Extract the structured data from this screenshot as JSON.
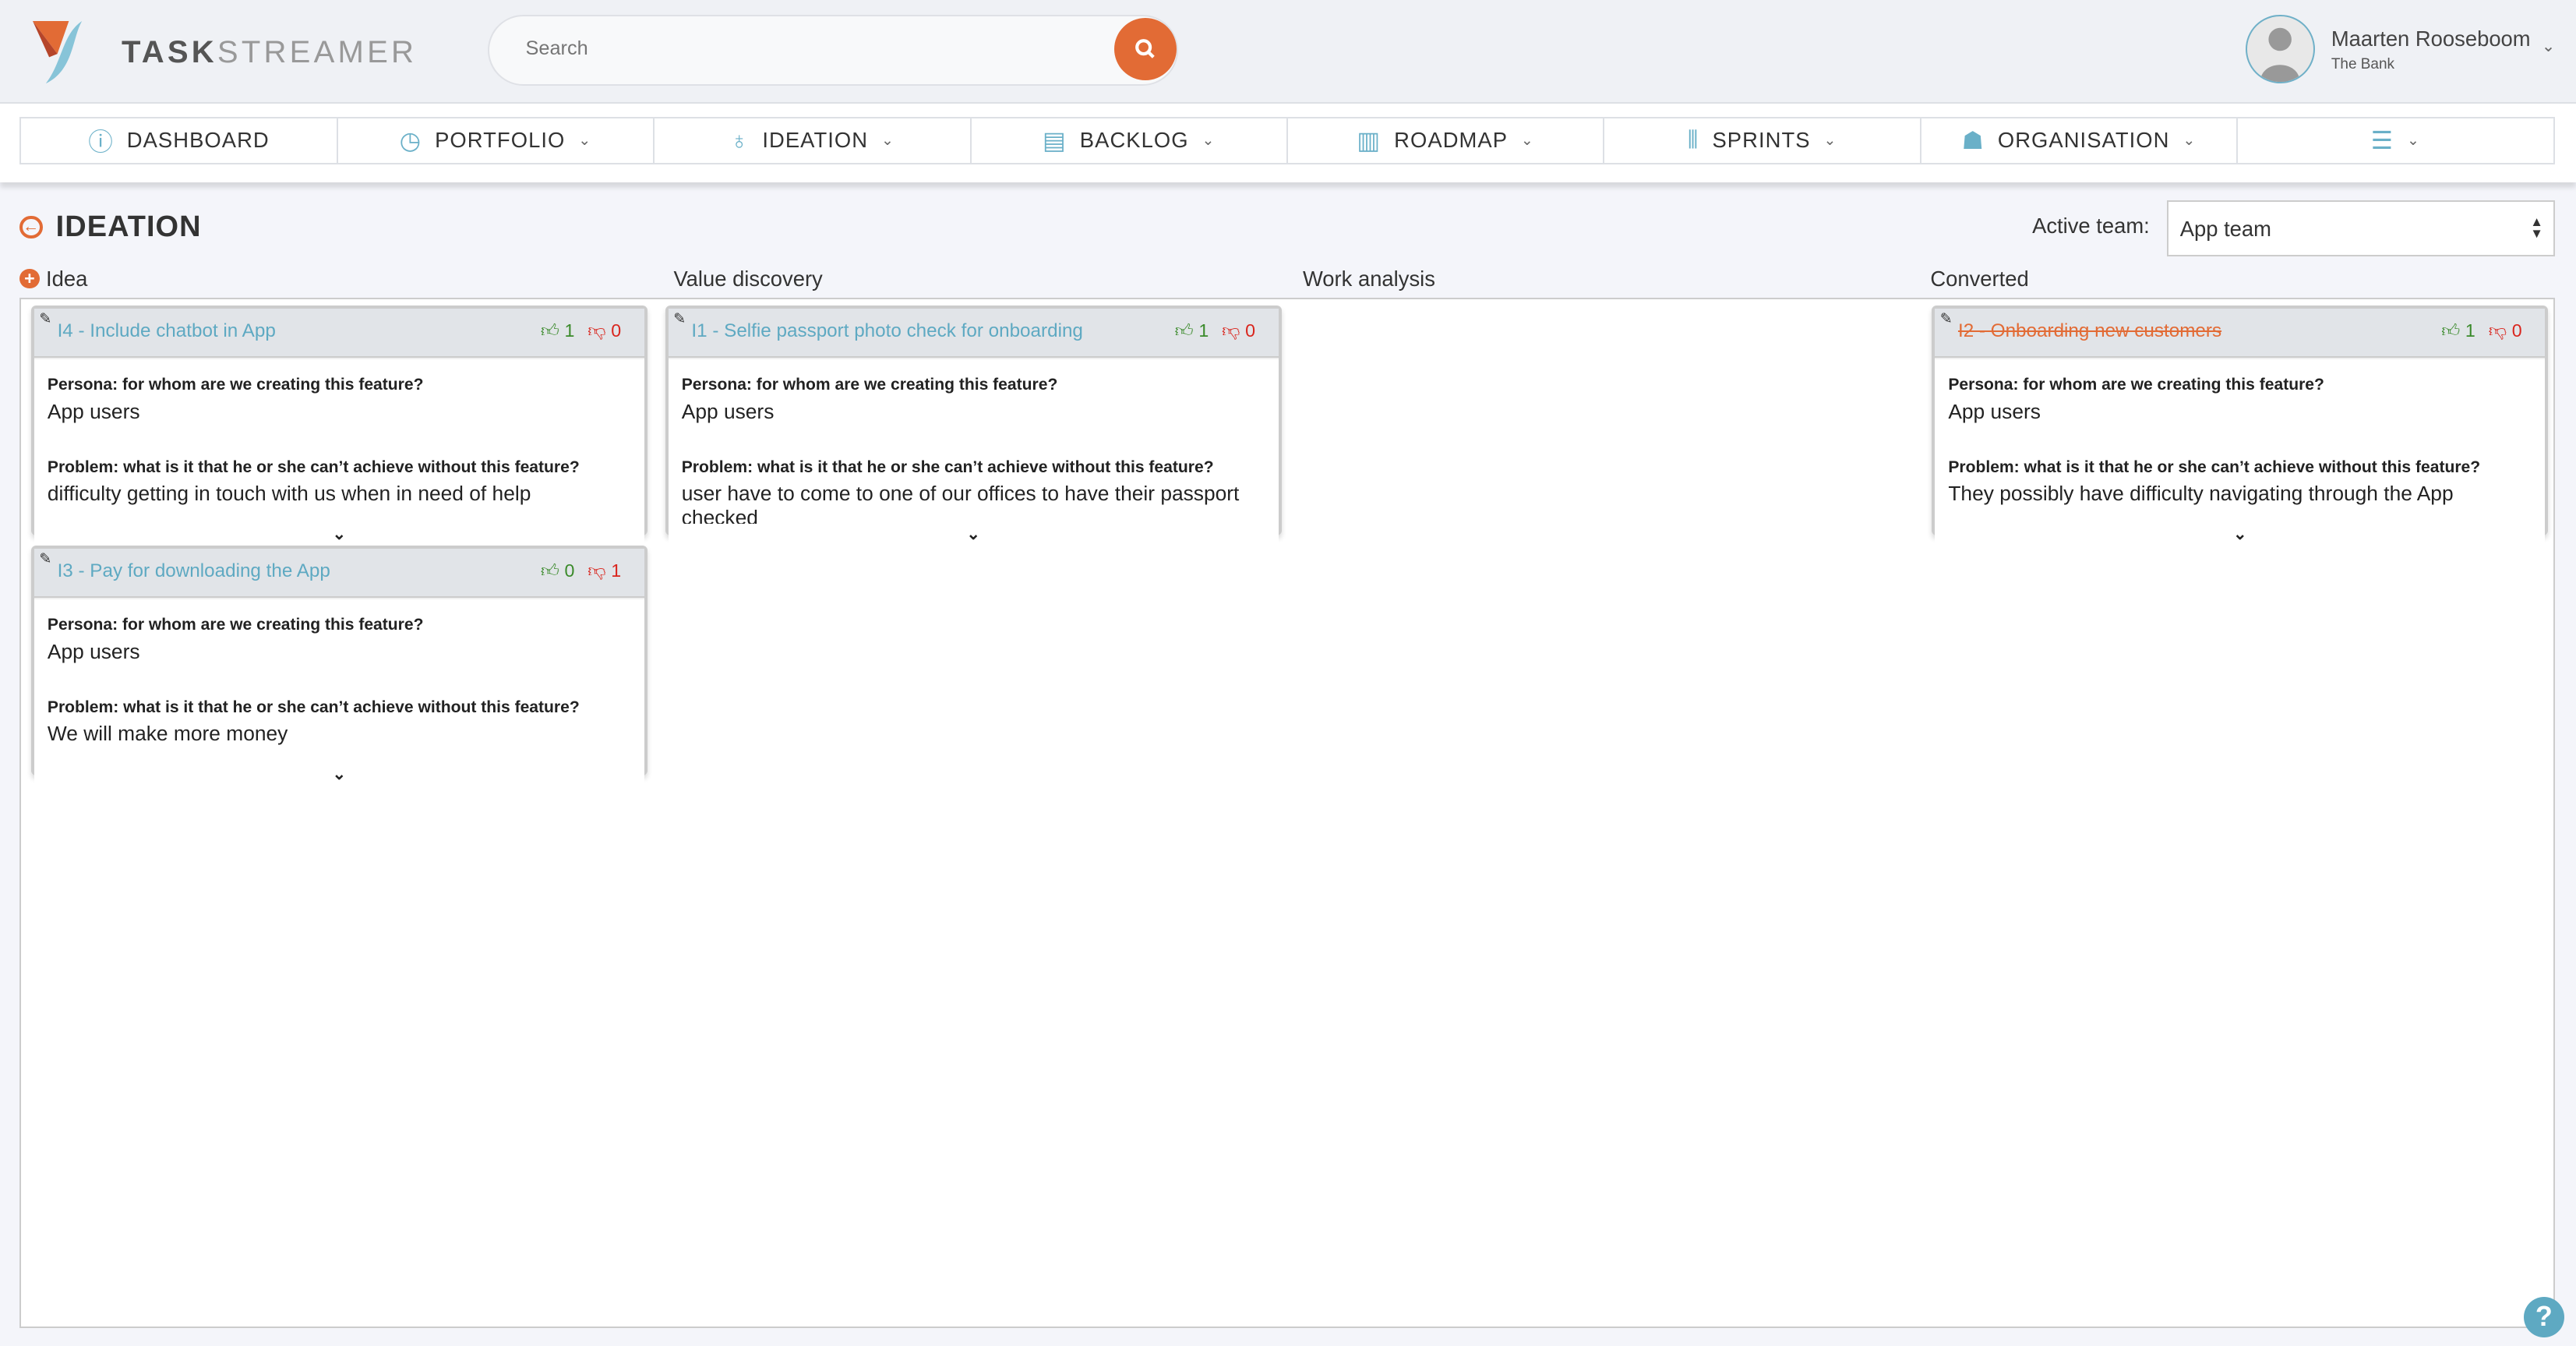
{
  "app": {
    "brand_bold": "TASK",
    "brand_light": "STREAMER"
  },
  "search": {
    "placeholder": "Search",
    "icon": "search-icon"
  },
  "user": {
    "name": "Maarten Rooseboom",
    "org": "The Bank"
  },
  "nav": [
    {
      "label": "DASHBOARD",
      "icon": "info-icon",
      "glyph": "ⓘ",
      "dropdown": false
    },
    {
      "label": "PORTFOLIO",
      "icon": "compass-icon",
      "glyph": "◷",
      "dropdown": true
    },
    {
      "label": "IDEATION",
      "icon": "lightbulb-icon",
      "glyph": "♁",
      "dropdown": true
    },
    {
      "label": "BACKLOG",
      "icon": "clipboard-icon",
      "glyph": "▤",
      "dropdown": true
    },
    {
      "label": "ROADMAP",
      "icon": "map-icon",
      "glyph": "▥",
      "dropdown": true
    },
    {
      "label": "SPRINTS",
      "icon": "barcode-icon",
      "glyph": "⦀",
      "dropdown": true
    },
    {
      "label": "ORGANISATION",
      "icon": "people-icon",
      "glyph": "☗",
      "dropdown": true
    },
    {
      "label": "",
      "icon": "sliders-icon",
      "glyph": "☰",
      "dropdown": true
    }
  ],
  "page": {
    "title": "IDEATION",
    "team_label": "Active team:",
    "team_value": "App team"
  },
  "columns": [
    "Idea",
    "Value discovery",
    "Work analysis",
    "Converted"
  ],
  "labels": {
    "persona": "Persona: for whom are we creating this feature?",
    "problem": "Problem: what is it that he or she can’t achieve without this feature?"
  },
  "cards": [
    {
      "column": 0,
      "row": 0,
      "title": "I4 - Include chatbot in App",
      "up": "1",
      "down": "0",
      "persona": "App users",
      "problem": "difficulty getting in touch with us when in need of help",
      "converted": false
    },
    {
      "column": 0,
      "row": 1,
      "title": "I3 - Pay for downloading the App",
      "up": "0",
      "down": "1",
      "persona": "App users",
      "problem": "We will make more money",
      "converted": false
    },
    {
      "column": 1,
      "row": 0,
      "title": "I1 - Selfie passport photo check for onboarding",
      "up": "1",
      "down": "0",
      "persona": "App users",
      "problem": "user have to come to one of our offices to have their passport checked",
      "converted": false
    },
    {
      "column": 3,
      "row": 0,
      "title": "I2 - Onboarding new customers",
      "up": "1",
      "down": "0",
      "persona": "App users",
      "problem": "They possibly have difficulty navigating through the App",
      "converted": true
    }
  ],
  "colors": {
    "accent": "#e26b35",
    "link": "#5ea9c2",
    "upvote": "#3a8a2a",
    "downvote": "#d9251d"
  }
}
